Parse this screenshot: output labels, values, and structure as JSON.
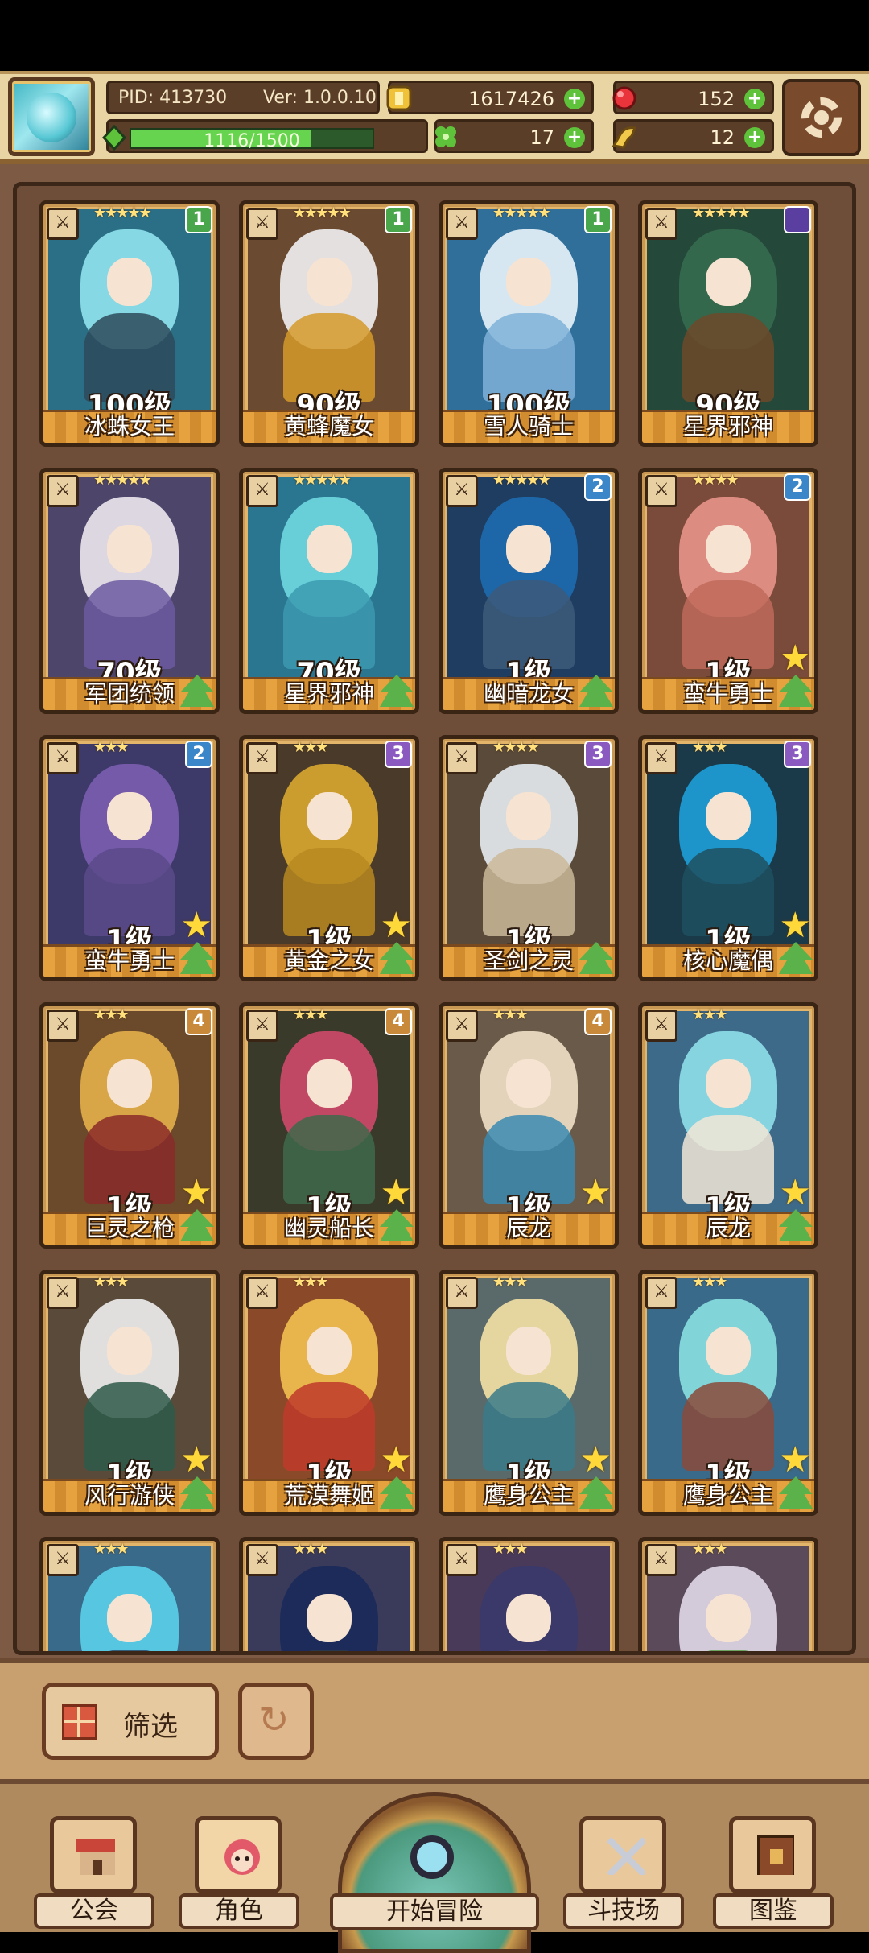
{
  "header": {
    "pid": "PID: 413730",
    "version": "Ver: 1.0.0.10",
    "xp_text": "1116/1500",
    "xp_progress": 0.744,
    "gold": "1617426",
    "gems": "152",
    "clover": "17",
    "horn": "12"
  },
  "cards": [
    {
      "name": "冰蛛女王",
      "level": "100级",
      "stars": "★★★★★",
      "rank": "1",
      "rank_color": "#4aa64a",
      "bg": "#2b6f86",
      "hair": "#8fe3ee",
      "body": "#2d4b5a",
      "upgrade": false,
      "bigstar": false
    },
    {
      "name": "黄蜂魔女",
      "level": "90级",
      "stars": "★★★★★",
      "rank": "1",
      "rank_color": "#4aa64a",
      "bg": "#6a4a30",
      "hair": "#f1f1f3",
      "body": "#d59a2a",
      "upgrade": false,
      "bigstar": false
    },
    {
      "name": "雪人骑士",
      "level": "100级",
      "stars": "★★★★★",
      "rank": "1",
      "rank_color": "#4aa64a",
      "bg": "#2f6f9a",
      "hair": "#e9f4fb",
      "body": "#7fb2d8",
      "upgrade": false,
      "bigstar": false
    },
    {
      "name": "星界邪神",
      "level": "90级",
      "stars": "★★★★★",
      "rank": "",
      "rank_color": "#5b3fa0",
      "bg": "#24483a",
      "hair": "#356b4f",
      "body": "#6d4a2a",
      "upgrade": false,
      "bigstar": false
    },
    {
      "name": "军团统领",
      "level": "70级",
      "stars": "★★★★★",
      "rank": "",
      "rank_color": "",
      "bg": "#4d466a",
      "hair": "#ede7f0",
      "body": "#6c5aa0",
      "upgrade": true,
      "bigstar": false
    },
    {
      "name": "星界邪神",
      "level": "70级",
      "stars": "★★★★★",
      "rank": "",
      "rank_color": "",
      "bg": "#2a7590",
      "hair": "#6fd8e0",
      "body": "#3c9ab0",
      "upgrade": true,
      "bigstar": false
    },
    {
      "name": "幽暗龙女",
      "level": "1级",
      "stars": "★★★★★",
      "rank": "2",
      "rank_color": "#3a86c8",
      "bg": "#1f3d60",
      "hair": "#1d6ab0",
      "body": "#3d5a7a",
      "upgrade": true,
      "bigstar": false
    },
    {
      "name": "蛮牛勇士",
      "level": "1级",
      "stars": "★★★★",
      "rank": "2",
      "rank_color": "#3a86c8",
      "bg": "#7a4a3a",
      "hair": "#e8948a",
      "body": "#c06a5a",
      "upgrade": true,
      "bigstar": true
    },
    {
      "name": "蛮牛勇士",
      "level": "1级",
      "stars": "★★★",
      "rank": "2",
      "rank_color": "#3a86c8",
      "bg": "#3d3a6a",
      "hair": "#7a5eb0",
      "body": "#5a4a8a",
      "upgrade": true,
      "bigstar": true
    },
    {
      "name": "黄金之女",
      "level": "1级",
      "stars": "★★★",
      "rank": "3",
      "rank_color": "#8a5ac0",
      "bg": "#4a3a2a",
      "hair": "#d9a930",
      "body": "#b88a20",
      "upgrade": true,
      "bigstar": true
    },
    {
      "name": "圣剑之灵",
      "level": "1级",
      "stars": "★★★★",
      "rank": "3",
      "rank_color": "#8a5ac0",
      "bg": "#5a4a3a",
      "hair": "#e6ecf2",
      "body": "#cbb89a",
      "upgrade": true,
      "bigstar": false
    },
    {
      "name": "核心魔偶",
      "level": "1级",
      "stars": "★★★",
      "rank": "3",
      "rank_color": "#8a5ac0",
      "bg": "#1a3a4a",
      "hair": "#1ea0d8",
      "body": "#1f5060",
      "upgrade": true,
      "bigstar": true
    },
    {
      "name": "巨灵之枪",
      "level": "1级",
      "stars": "★★★",
      "rank": "4",
      "rank_color": "#c88a3a",
      "bg": "#6a4a2a",
      "hair": "#e6b04a",
      "body": "#8a2a2a",
      "upgrade": true,
      "bigstar": true
    },
    {
      "name": "幽灵船长",
      "level": "1级",
      "stars": "★★★",
      "rank": "4",
      "rank_color": "#c88a3a",
      "bg": "#3a3a2a",
      "hair": "#d04a6a",
      "body": "#3e6a4a",
      "upgrade": true,
      "bigstar": true
    },
    {
      "name": "辰龙",
      "level": "1级",
      "stars": "★★★",
      "rank": "4",
      "rank_color": "#c88a3a",
      "bg": "#6a5a4a",
      "hair": "#efe0c6",
      "body": "#3a8ab0",
      "upgrade": false,
      "bigstar": true
    },
    {
      "name": "辰龙",
      "level": "1级",
      "stars": "★★★",
      "rank": "",
      "rank_color": "",
      "bg": "#3e6a8a",
      "hair": "#8fe0ea",
      "body": "#f2e6d6",
      "upgrade": true,
      "bigstar": true
    },
    {
      "name": "风行游侠",
      "level": "1级",
      "stars": "★★★",
      "rank": "",
      "rank_color": "",
      "bg": "#5a4a3a",
      "hair": "#f0f0f0",
      "body": "#2e5a4a",
      "upgrade": true,
      "bigstar": true
    },
    {
      "name": "荒漠舞姬",
      "level": "1级",
      "stars": "★★★",
      "rank": "",
      "rank_color": "",
      "bg": "#8a4a2a",
      "hair": "#f2c050",
      "body": "#c03a2a",
      "upgrade": true,
      "bigstar": true
    },
    {
      "name": "鹰身公主",
      "level": "1级",
      "stars": "★★★",
      "rank": "",
      "rank_color": "",
      "bg": "#5a6a6a",
      "hair": "#f4e2a6",
      "body": "#3a7a8a",
      "upgrade": true,
      "bigstar": true
    },
    {
      "name": "鹰身公主",
      "level": "1级",
      "stars": "★★★",
      "rank": "",
      "rank_color": "",
      "bg": "#3a6a8a",
      "hair": "#8ae0e0",
      "body": "#8a4a3a",
      "upgrade": true,
      "bigstar": true
    },
    {
      "name": "",
      "level": "",
      "stars": "★★★",
      "rank": "",
      "rank_color": "",
      "bg": "#3a6a8a",
      "hair": "#5ad0ea",
      "body": "#2a4a6a",
      "upgrade": false,
      "bigstar": false
    },
    {
      "name": "",
      "level": "",
      "stars": "★★★",
      "rank": "",
      "rank_color": "",
      "bg": "#3a3a5a",
      "hair": "#1a2a5a",
      "body": "#2a3a4a",
      "upgrade": false,
      "bigstar": false
    },
    {
      "name": "",
      "level": "",
      "stars": "★★★",
      "rank": "",
      "rank_color": "",
      "bg": "#4a3a5a",
      "hair": "#3a3a6a",
      "body": "#5a4a7a",
      "upgrade": false,
      "bigstar": false
    },
    {
      "name": "",
      "level": "",
      "stars": "★★★",
      "rank": "",
      "rank_color": "",
      "bg": "#5a4a5a",
      "hair": "#e0d8e8",
      "body": "#5aa04a",
      "upgrade": false,
      "bigstar": false
    }
  ],
  "filter": {
    "label": "筛选"
  },
  "nav": {
    "guild": "公会",
    "character": "角色",
    "adventure": "开始冒险",
    "arena": "斗技场",
    "codex": "图鉴"
  }
}
